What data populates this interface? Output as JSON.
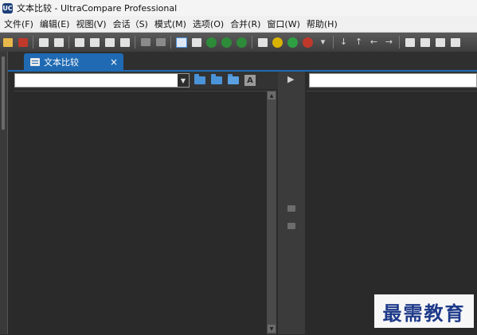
{
  "window": {
    "title": "文本比较 - UltraCompare Professional"
  },
  "menu": [
    "文件(F)",
    "编辑(E)",
    "视图(V)",
    "会话（S)",
    "模式(M)",
    "选项(O)",
    "合并(R)",
    "窗口(W)",
    "帮助(H)"
  ],
  "toolbar": {
    "icons": [
      "open-icon",
      "ftp-icon",
      "separator",
      "save-icon",
      "print-icon",
      "separator",
      "folder-compare-icon",
      "binary-compare-icon",
      "table-compare-icon",
      "text-compare-icon",
      "separator",
      "clear-icon",
      "stop-icon",
      "separator",
      "two-way-icon",
      "three-way-icon",
      "mode-1-icon",
      "mode-2-icon",
      "mode-3-icon",
      "separator",
      "refresh-icon",
      "yellow-circle-icon",
      "green-circle-icon",
      "red-circle-icon",
      "dropdown-icon",
      "separator",
      "next-diff-icon",
      "prev-diff-icon",
      "merge-left-icon",
      "merge-right-icon",
      "separator",
      "bookmark-icon",
      "save-all-icon",
      "report-icon",
      "settings-icon"
    ]
  },
  "tab": {
    "label": "文本比较",
    "close": "×"
  },
  "left_pane": {
    "path_value": ""
  },
  "right_pane": {
    "path_value": ""
  },
  "pane_buttons": {
    "font_label": "A"
  },
  "divider": {
    "arrow": "▶"
  },
  "watermark": "最需教育"
}
